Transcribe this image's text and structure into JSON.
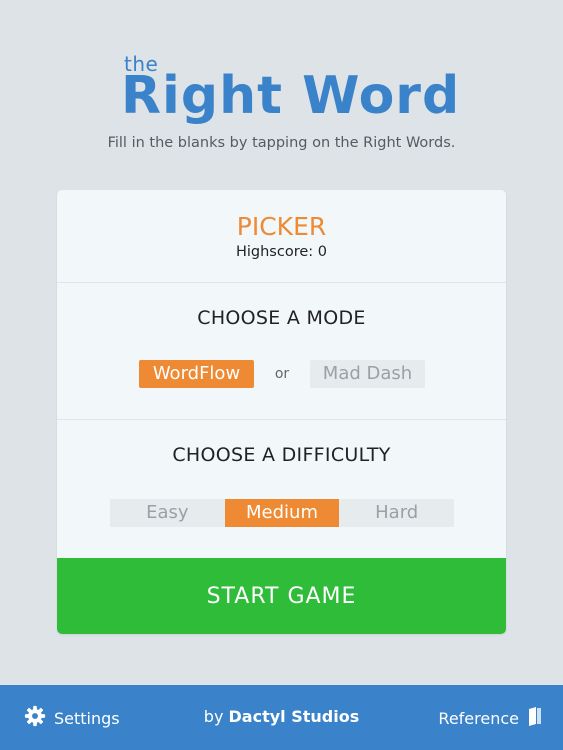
{
  "header": {
    "logo_small": "the",
    "logo_main": "Right Word",
    "subtitle": "Fill in the blanks by tapping on the Right Words."
  },
  "card": {
    "game_name": "PICKER",
    "highscore_label": "Highscore:",
    "highscore_value": "0",
    "mode": {
      "title": "CHOOSE A MODE",
      "options": [
        "WordFlow",
        "Mad Dash"
      ],
      "separator": "or",
      "selected": "WordFlow"
    },
    "difficulty": {
      "title": "CHOOSE A DIFFICULTY",
      "options": [
        "Easy",
        "Medium",
        "Hard"
      ],
      "selected": "Medium"
    },
    "start_label": "START GAME"
  },
  "footer": {
    "settings_label": "Settings",
    "byline_prefix": "by",
    "byline_name": "Dactyl Studios",
    "reference_label": "Reference",
    "settings_icon": "gear-icon",
    "reference_icon": "book-icon"
  },
  "colors": {
    "brand_blue": "#3a82c9",
    "accent_orange": "#ee8a33",
    "start_green": "#2fbc39",
    "background": "#dde3e7"
  }
}
